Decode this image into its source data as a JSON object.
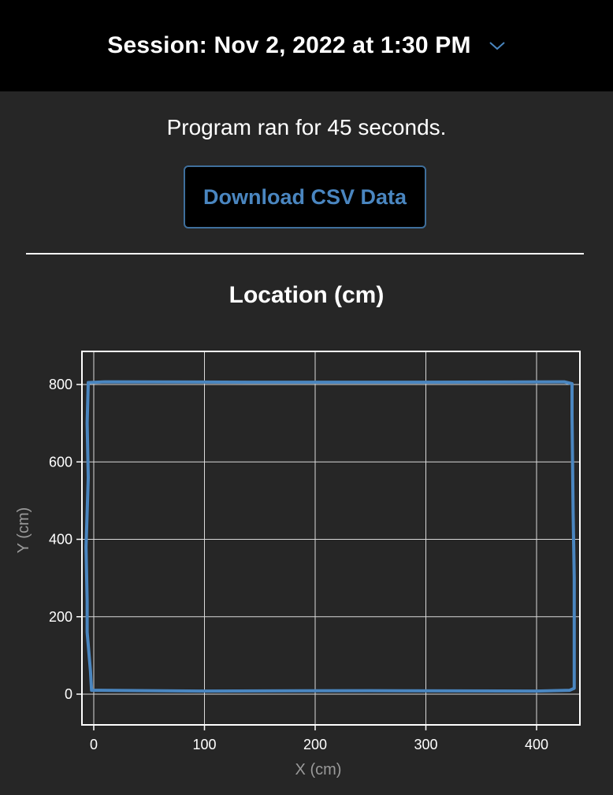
{
  "header": {
    "session_title": "Session: Nov 2, 2022 at 1:30 PM"
  },
  "summary": {
    "runtime_text": "Program ran for 45 seconds."
  },
  "actions": {
    "download_label": "Download CSV Data"
  },
  "chart": {
    "title": "Location (cm)"
  },
  "colors": {
    "background": "#262626",
    "header": "#000000",
    "accent": "#4a86c0",
    "path": "#4a86c0",
    "grid": "#d9d9d9"
  },
  "icons": {
    "dropdown": "chevron-down-icon"
  },
  "chart_data": {
    "type": "line",
    "title": "Location (cm)",
    "xlabel": "X (cm)",
    "ylabel": "Y (cm)",
    "xlim": [
      -10,
      440
    ],
    "ylim": [
      -80,
      880
    ],
    "xticks": [
      0,
      100,
      200,
      300,
      400
    ],
    "yticks": [
      0,
      200,
      400,
      600,
      800
    ],
    "grid": true,
    "series": [
      {
        "x": [
          -4,
          10,
          140,
          300,
          425,
          432,
          432,
          433,
          434,
          434,
          430,
          400,
          250,
          100,
          -2,
          -3,
          -6,
          -6,
          -7,
          -5,
          -6,
          -5
        ],
        "y": [
          805,
          807,
          806,
          806,
          807,
          802,
          720,
          470,
          300,
          15,
          10,
          8,
          9,
          8,
          10,
          60,
          160,
          240,
          380,
          560,
          700,
          805
        ]
      }
    ]
  }
}
